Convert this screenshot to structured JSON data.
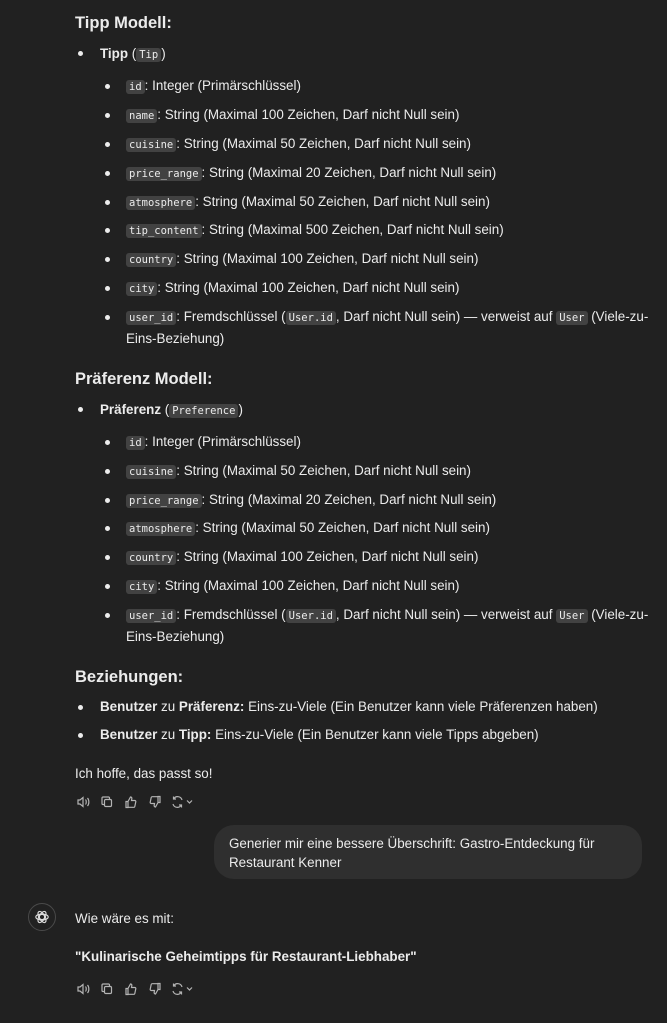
{
  "tip_section": {
    "heading": "Tipp Modell:",
    "model_name": "Tipp",
    "model_code": "Tip",
    "fields": [
      {
        "code": "id",
        "desc": ": Integer (Primärschlüssel)"
      },
      {
        "code": "name",
        "desc": ": String (Maximal 100 Zeichen, Darf nicht Null sein)"
      },
      {
        "code": "cuisine",
        "desc": ": String (Maximal 50 Zeichen, Darf nicht Null sein)"
      },
      {
        "code": "price_range",
        "desc": ": String (Maximal 20 Zeichen, Darf nicht Null sein)"
      },
      {
        "code": "atmosphere",
        "desc": ": String (Maximal 50 Zeichen, Darf nicht Null sein)"
      },
      {
        "code": "tip_content",
        "desc": ": String (Maximal 500 Zeichen, Darf nicht Null sein)"
      },
      {
        "code": "country",
        "desc": ": String (Maximal 100 Zeichen, Darf nicht Null sein)"
      },
      {
        "code": "city",
        "desc": ": String (Maximal 100 Zeichen, Darf nicht Null sein)"
      }
    ],
    "fk": {
      "code": "user_id",
      "text1": ": Fremdschlüssel (",
      "ref_code": "User.id",
      "text2": ", Darf nicht Null sein) — verweist auf ",
      "target_code": "User",
      "text3": " (Viele-zu-",
      "text4": "Eins-Beziehung)"
    }
  },
  "pref_section": {
    "heading": "Präferenz Modell:",
    "model_name": "Präferenz",
    "model_code": "Preference",
    "fields": [
      {
        "code": "id",
        "desc": ": Integer (Primärschlüssel)"
      },
      {
        "code": "cuisine",
        "desc": ": String (Maximal 50 Zeichen, Darf nicht Null sein)"
      },
      {
        "code": "price_range",
        "desc": ": String (Maximal 20 Zeichen, Darf nicht Null sein)"
      },
      {
        "code": "atmosphere",
        "desc": ": String (Maximal 50 Zeichen, Darf nicht Null sein)"
      },
      {
        "code": "country",
        "desc": ": String (Maximal 100 Zeichen, Darf nicht Null sein)"
      },
      {
        "code": "city",
        "desc": ": String (Maximal 100 Zeichen, Darf nicht Null sein)"
      }
    ],
    "fk": {
      "code": "user_id",
      "text1": ": Fremdschlüssel (",
      "ref_code": "User.id",
      "text2": ", Darf nicht Null sein) — verweist auf ",
      "target_code": "User",
      "text3": " (Viele-zu-",
      "text4": "Eins-Beziehung)"
    }
  },
  "relations": {
    "heading": "Beziehungen:",
    "items": [
      {
        "a": "Benutzer",
        "mid": " zu ",
        "b": "Präferenz:",
        "rest": " Eins-zu-Viele (Ein Benutzer kann viele Präferenzen haben)"
      },
      {
        "a": "Benutzer",
        "mid": " zu ",
        "b": "Tipp:",
        "rest": " Eins-zu-Viele (Ein Benutzer kann viele Tipps abgeben)"
      }
    ]
  },
  "closing": "Ich hoffe, das passt so!",
  "user_message": "Generier mir eine bessere Überschrift: Gastro-Entdeckung für Restaurant Kenner",
  "assistant_reply": {
    "intro": "Wie wäre es mit:",
    "suggestion": "\"Kulinarische Geheimtipps für Restaurant-Liebhaber\""
  },
  "icons": [
    "read-aloud-icon",
    "copy-icon",
    "thumbs-up-icon",
    "thumbs-down-icon",
    "regenerate-icon",
    "chevron-down-icon",
    "chatgpt-logo-icon"
  ]
}
